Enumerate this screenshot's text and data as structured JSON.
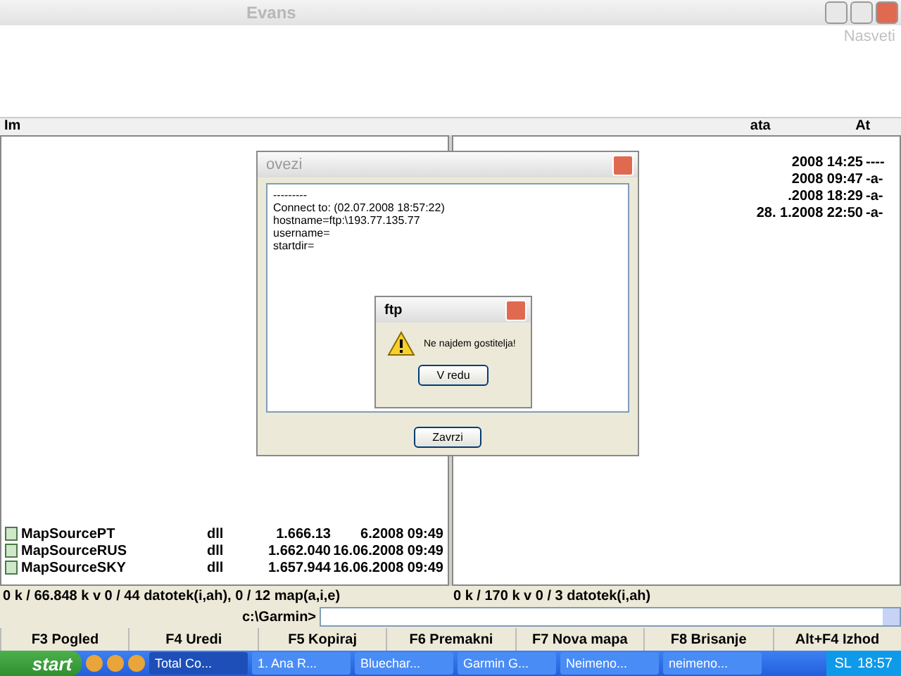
{
  "window": {
    "title": "Evans",
    "menu_right": "Nasveti"
  },
  "left_panel": {
    "header": "Im",
    "rows": [
      {
        "name": "MapSourcePT",
        "ext": "dll",
        "size": "1.666.13",
        "date": "6.2008 09:49"
      },
      {
        "name": "MapSourceRUS",
        "ext": "dll",
        "size": "1.662.040",
        "date": "16.06.2008 09:49"
      },
      {
        "name": "MapSourceSKY",
        "ext": "dll",
        "size": "1.657.944",
        "date": "16.06.2008 09:49"
      }
    ]
  },
  "right_panel": {
    "headers": [
      "ata",
      "At"
    ],
    "rows": [
      {
        "date": "2008 14:25",
        "attr": "----"
      },
      {
        "date": "2008 09:47",
        "attr": "-a-"
      },
      {
        "date": ".2008 18:29",
        "attr": "-a-"
      },
      {
        "date": "28. 1.2008 22:50",
        "attr": "-a-"
      }
    ]
  },
  "connect_dialog": {
    "title": "ovezi",
    "log": [
      "---------",
      "Connect to: (02.07.2008 18:57:22)",
      "hostname=ftp:\\193.77.135.77",
      "username=",
      "startdir="
    ],
    "button": "Zavrzi"
  },
  "message_box": {
    "title": "ftp",
    "message": "Ne najdem gostitelja!",
    "button": "V redu"
  },
  "status_bar": [
    "0 k / 66.848 k v 0 / 44 datotek(i,ah), 0 / 12 map(a,i,e)",
    "0 k / 170 k v 0 / 3 datotek(i,ah)"
  ],
  "command_line": {
    "prompt": "c:\\Garmin>"
  },
  "function_keys": [
    "F3 Pogled",
    "F4 Uredi",
    "F5 Kopiraj",
    "F6 Premakni",
    "F7 Nova mapa",
    "F8 Brisanje",
    "Alt+F4 Izhod"
  ],
  "taskbar": {
    "start": "start",
    "tasks": [
      {
        "label": "Total Co...",
        "selected": true
      },
      {
        "label": "1. Ana R...",
        "selected": false
      },
      {
        "label": "Bluechar...",
        "selected": false
      },
      {
        "label": "Garmin G...",
        "selected": false
      },
      {
        "label": "Neimeno...",
        "selected": false
      },
      {
        "label": "neimeno...",
        "selected": false
      }
    ],
    "language": "SL",
    "clock": "18:57"
  }
}
